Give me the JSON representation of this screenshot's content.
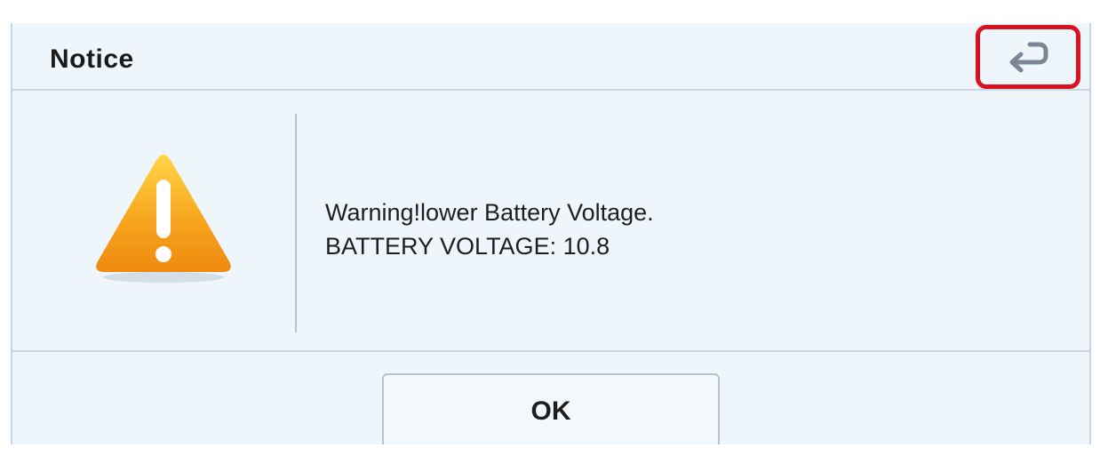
{
  "dialog": {
    "title": "Notice",
    "back_icon": "return-arrow-icon",
    "warning_icon": "warning-triangle-icon",
    "message_line1": "Warning!lower Battery Voltage.",
    "message_line2": "BATTERY VOLTAGE: 10.8",
    "ok_label": "OK"
  },
  "colors": {
    "dialog_background": "#eef6fc",
    "highlight_border": "#d9121f",
    "warning_fill": "#f5a623"
  }
}
